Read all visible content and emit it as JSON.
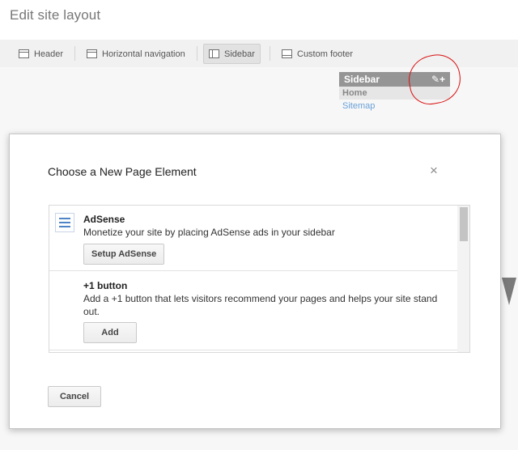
{
  "page": {
    "title": "Edit site layout"
  },
  "toolbar": {
    "items": [
      {
        "label": "Header",
        "icon": "header-layout-icon",
        "active": false
      },
      {
        "label": "Horizontal navigation",
        "icon": "horizontal-navigation-layout-icon",
        "active": false
      },
      {
        "label": "Sidebar",
        "icon": "sidebar-layout-icon",
        "active": true
      },
      {
        "label": "Custom footer",
        "icon": "footer-layout-icon",
        "active": false
      }
    ]
  },
  "sidebar_widget": {
    "title": "Sidebar",
    "tools": "✎+",
    "items": [
      "Home",
      "Sitemap"
    ]
  },
  "annotation": {
    "color": "#d90e0e",
    "shape": "hand-drawn red circle around sidebar edit/add tools"
  },
  "dialog": {
    "title": "Choose a New Page Element",
    "close_symbol": "×",
    "elements": [
      {
        "title": "AdSense",
        "description": "Monetize your site by placing AdSense ads in your sidebar",
        "button": "Setup AdSense",
        "icon": "adsense-icon"
      },
      {
        "title": "+1 button",
        "description": "Add a +1 button that lets visitors recommend your pages and helps your site stand out.",
        "button": "Add"
      }
    ],
    "cancel": "Cancel"
  },
  "colors": {
    "accent_link": "#6aa0d8",
    "sidebar_header": "#959595",
    "annotation": "#d90e0e"
  }
}
